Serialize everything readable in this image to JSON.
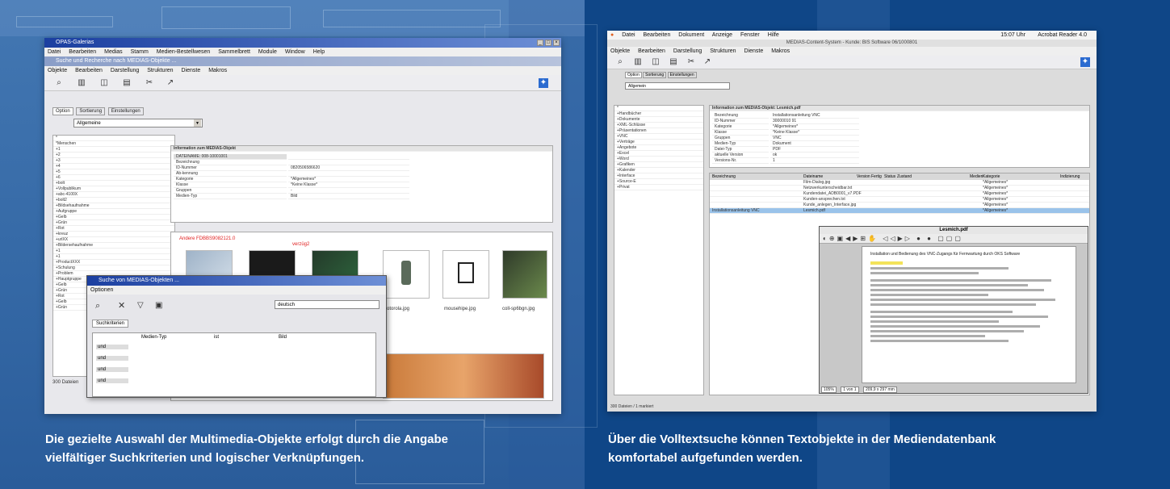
{
  "captions": {
    "left_line1": "Die gezielte Auswahl der Multimedia-Objekte erfolgt durch die Angabe",
    "left_line2": "vielfältiger Suchkriterien und logischer Verknüpfungen.",
    "right_line1": "Über die Volltextsuche können Textobjekte in der Mediendatenbank",
    "right_line2": "komfortabel aufgefunden werden."
  },
  "left_screenshot": {
    "app_title": "OPAS-Galerias",
    "menu": [
      "Datei",
      "Bearbeiten",
      "Medias",
      "Stamm",
      "Medien-Bestellwesen",
      "Sammelbrett",
      "Module",
      "Window",
      "Help"
    ],
    "inner_title": "Suche und Recherche nach MEDIAS-Objekte ...",
    "inner_menu": [
      "Objekte",
      "Bearbeiten",
      "Darstellung",
      "Strukturen",
      "Dienste",
      "Makros"
    ],
    "tabs": [
      "Option",
      "Sortierung",
      "Einstellungen"
    ],
    "dropdown_value": "Allgemeine",
    "info_title": "Information zum MEDIAS-Objekt",
    "info_rows": [
      "DATEINAME: 008-10001001",
      "Bezeichnung",
      "ID-Nummer",
      "Ab-kennung",
      "Kategorie",
      "Klasse",
      "Gruppen",
      "Medien-Typ"
    ],
    "info_values": [
      "",
      "",
      "0820506586620",
      "",
      "*Allgemeines*",
      "*Keine Klasse*",
      "-",
      "Bild"
    ],
    "preview_link": "Andere FDBBS9082121.0",
    "preview_sub": "verzüg2",
    "thumb_labels": [
      "motorola.jpg",
      "mousehipe.jpg",
      "coll-sp6bgn.jpg"
    ],
    "list_items": [
      "*",
      "*Menschen",
      "+1",
      "+2",
      "+3",
      "+4",
      "+5",
      "+6",
      "+bolt",
      "+Vollpublikum",
      "+abc-4100X",
      "+bolt2",
      "+Bildsehaufnahme",
      "+Aufgruppe",
      "+Gelb",
      "+Grün",
      "+Rot",
      "+kreuz",
      "+urlXX",
      "+Bildersehaufnahme",
      "+1",
      "+1",
      "+ProductXXX",
      "+Schulung",
      "+Problem",
      "+Hauptgruppe",
      "+Gelb",
      "+Grün",
      "+Rot",
      "+Gelb",
      "+Grün"
    ],
    "status": "300 Dateien",
    "dialog_title": "Suche von MEDIAS-Objekten ...",
    "dialog_menu": "Optionen",
    "dialog_lang": "deutsch",
    "dialog_tab": "Suchkriterien",
    "dialog_cols": [
      "Medien-Typ",
      "ist",
      "Bild"
    ],
    "dialog_ops": [
      "und",
      "und",
      "und",
      "und"
    ]
  },
  "right_screenshot": {
    "os_menu": [
      "Datei",
      "Bearbeiten",
      "Dokument",
      "Anzeige",
      "Fenster",
      "Hilfe"
    ],
    "clock": "15:07 Uhr",
    "reader": "Acrobat Reader 4.0",
    "app_title": "MEDIAS-Content-System - Kunde: BIS Software 06/1000801",
    "app_menu": [
      "Objekte",
      "Bearbeiten",
      "Darstellung",
      "Strukturen",
      "Dienste",
      "Makros"
    ],
    "tabs": [
      "Option",
      "Sortierung",
      "Einstellungen"
    ],
    "dropdown_value": "Allgemein",
    "info_title": "Information zum MEDIAS-Objekt: Lesmich.pdf",
    "info_rows": [
      "Bezeichnung",
      "ID-Nummer",
      "Kategorie",
      "Klasse",
      "Gruppen",
      "Medien-Typ",
      "Datei-Typ",
      "aktuelle Version",
      "Versions-Nr."
    ],
    "info_values": [
      "Installationsanleitung VNC",
      "30000010 91",
      "*Allgemeines*",
      "*Keine Klasse*",
      "VNC",
      "Dokument",
      "PDF",
      "ok",
      "1"
    ],
    "table_headers": [
      "Bezeichnung",
      "Dateiname",
      "Version",
      "Fertig",
      "Status",
      "Zustand",
      "Medien",
      "Kategorie",
      "Indizierung"
    ],
    "table_files": [
      "Film-Dialog.jpg",
      "Netzwerkunterscheidbar.txt",
      "Kundendatei_ADB0001_v7.PDF",
      "Kunden-ansprechen.txt",
      "Kunde_anlegen_Interface.jpg",
      "Lesmich.pdf"
    ],
    "table_category": "*Allgemeines*",
    "selected_label": "Installationsanleitung VNC",
    "pdf_title": "Lesmich.pdf",
    "pdf_heading": "Installation und Bedienung des VNC-Zugangs für Fernwartung durch OKS Software",
    "pdf_footer": "300 Dateien / 1 markiert",
    "pdf_zoom": "105%",
    "pdf_page": "1 von 1",
    "pdf_size": "209,9 x 297 mm",
    "left_list": [
      "*",
      "+Handbücher",
      "+Dokumente",
      "+XML-Schlüsse",
      "+Präsentationen",
      "+VNC",
      "+Verträge",
      "+Angebote",
      "+Excel",
      "+Word",
      "+Grafiken",
      "+Kalender",
      "+Interface",
      "+Source-E",
      "+Privat"
    ]
  },
  "colors": {
    "background_left": "#3f74b0",
    "background_right": "#0f4687",
    "caption_text": "#ffffff",
    "titlebar": "#1b3fa0",
    "selection": "#9ac3ea"
  }
}
